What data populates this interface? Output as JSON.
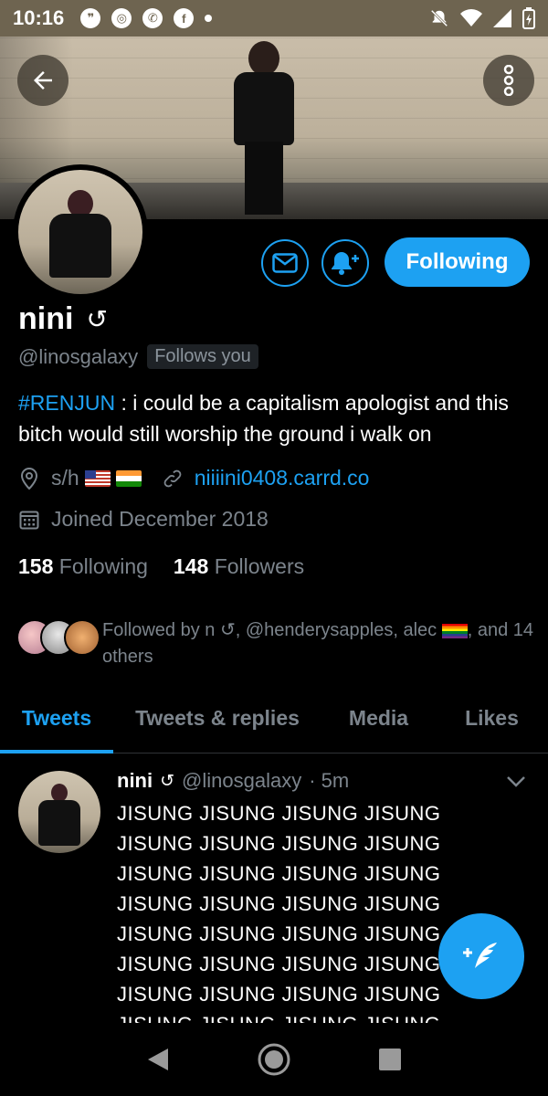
{
  "status_bar": {
    "time": "10:16"
  },
  "profile": {
    "name": "nini",
    "name_symbol": "↺",
    "handle": "@linosgalaxy",
    "follows_you": "Follows you",
    "bio_hashtag": "#RENJUN",
    "bio_text": " : i could be a capitalism apologist and this bitch would still worship the ground i walk on",
    "location": "s/h",
    "website": "niiiini0408.carrd.co",
    "joined": "Joined December 2018",
    "following_count": "158",
    "following_label": "Following",
    "followers_count": "148",
    "followers_label": "Followers",
    "followed_by_prefix": "Followed by n ",
    "followed_by_sym": "↺",
    "followed_by_names": ", @henderysapples, alec ",
    "followed_by_suffix": ", and 14 others",
    "follow_button_label": "Following"
  },
  "tabs": [
    {
      "label": "Tweets",
      "active": true
    },
    {
      "label": "Tweets & replies",
      "active": false
    },
    {
      "label": "Media",
      "active": false
    },
    {
      "label": "Likes",
      "active": false
    }
  ],
  "tweet": {
    "name": "nini",
    "name_symbol": "↺",
    "handle": "@linosgalaxy",
    "time": "· 5m",
    "lines": [
      "JISUNG JISUNG JISUNG JISUNG",
      "JISUNG JISUNG JISUNG JISUNG",
      "JISUNG JISUNG JISUNG JISUNG",
      "JISUNG JISUNG JISUNG JISUNG",
      "JISUNG JISUNG JISUNG JISUNG",
      "JISUNG JISUNG JISUNG JISUNG",
      "JISUNG JISUNG JISUNG JISUNG",
      "JISUNG JISUNG JISUNG JISUNG"
    ]
  },
  "colors": {
    "accent": "#1da1f2",
    "muted": "#7c848c",
    "background": "#000000"
  },
  "icons": {
    "back": "arrow-left-icon",
    "more": "more-vertical-icon",
    "mail": "mail-icon",
    "bell": "bell-plus-icon",
    "location": "location-pin-icon",
    "link": "link-icon",
    "calendar": "calendar-icon",
    "compose": "compose-tweet-icon"
  }
}
